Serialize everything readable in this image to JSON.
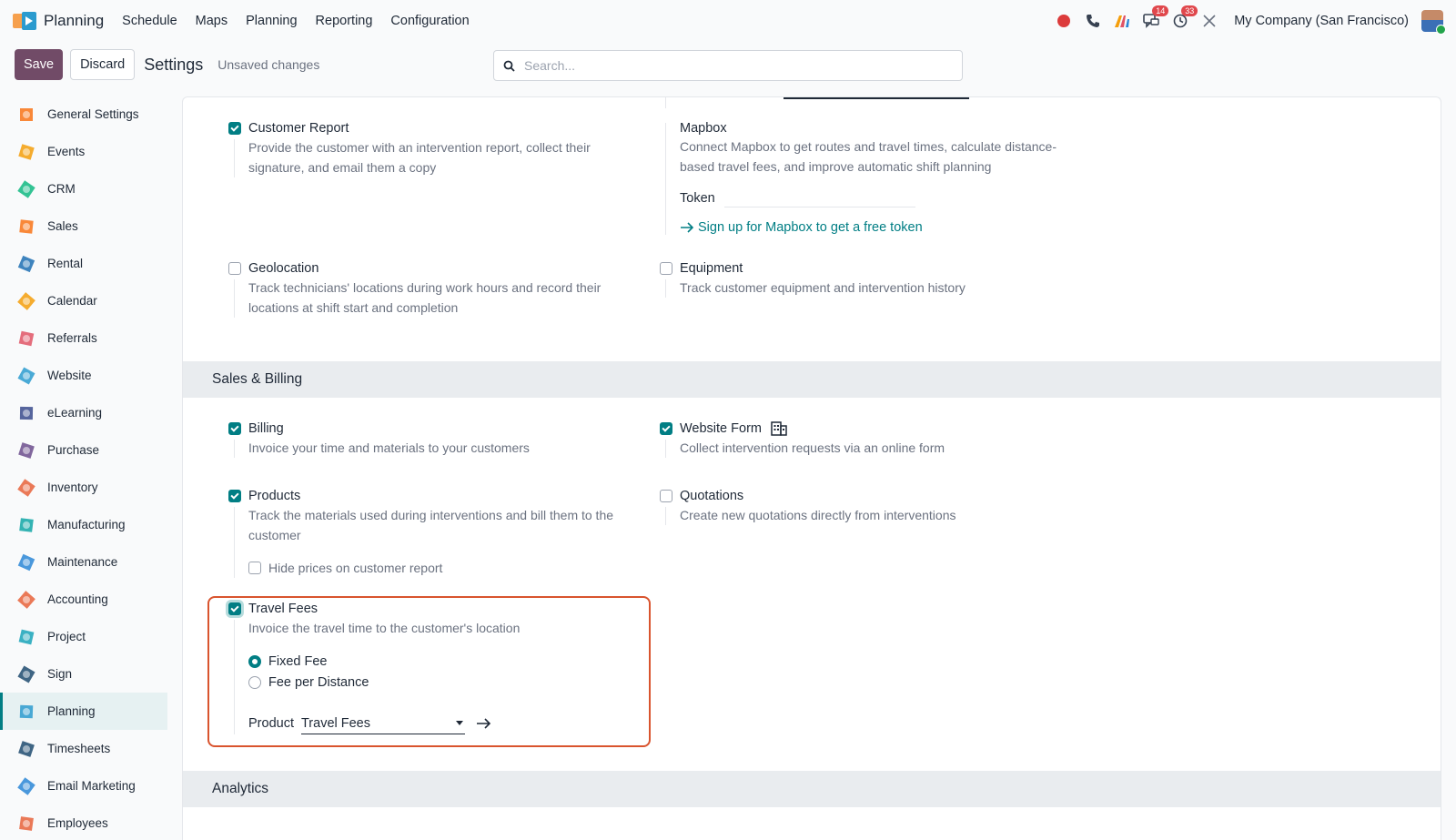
{
  "topbar": {
    "app_name": "Planning",
    "menu": [
      "Schedule",
      "Maps",
      "Planning",
      "Reporting",
      "Configuration"
    ],
    "messages_badge": "14",
    "activities_badge": "33",
    "company": "My Company (San Francisco)"
  },
  "controls": {
    "save": "Save",
    "discard": "Discard",
    "title": "Settings",
    "status": "Unsaved changes",
    "search_placeholder": "Search..."
  },
  "sidebar": {
    "items": [
      {
        "label": "General Settings",
        "icon": "general-settings-icon",
        "color": "#f97316"
      },
      {
        "label": "Events",
        "icon": "events-icon",
        "color": "#f59e0b"
      },
      {
        "label": "CRM",
        "icon": "crm-icon",
        "color": "#10b981"
      },
      {
        "label": "Sales",
        "icon": "sales-icon",
        "color": "#f97316"
      },
      {
        "label": "Rental",
        "icon": "rental-icon",
        "color": "#1e6fb3"
      },
      {
        "label": "Calendar",
        "icon": "calendar-icon",
        "color": "#f59e0b"
      },
      {
        "label": "Referrals",
        "icon": "referrals-icon",
        "color": "#e05365"
      },
      {
        "label": "Website",
        "icon": "website-icon",
        "color": "#2b9bcf"
      },
      {
        "label": "eLearning",
        "icon": "elearning-icon",
        "color": "#3a4a8c"
      },
      {
        "label": "Purchase",
        "icon": "purchase-icon",
        "color": "#6c4c8c"
      },
      {
        "label": "Inventory",
        "icon": "inventory-icon",
        "color": "#e8613a"
      },
      {
        "label": "Manufacturing",
        "icon": "manufacturing-icon",
        "color": "#12a6a6"
      },
      {
        "label": "Maintenance",
        "icon": "maintenance-icon",
        "color": "#2b86d6"
      },
      {
        "label": "Accounting",
        "icon": "accounting-icon",
        "color": "#e8613a"
      },
      {
        "label": "Project",
        "icon": "project-icon",
        "color": "#1aa3b8"
      },
      {
        "label": "Sign",
        "icon": "sign-icon",
        "color": "#1f4a6e"
      },
      {
        "label": "Planning",
        "icon": "planning-icon",
        "color": "#2b9bcf"
      },
      {
        "label": "Timesheets",
        "icon": "timesheets-icon",
        "color": "#1f4a6e"
      },
      {
        "label": "Email Marketing",
        "icon": "email-marketing-icon",
        "color": "#2b86d6"
      },
      {
        "label": "Employees",
        "icon": "employees-icon",
        "color": "#e8613a"
      }
    ],
    "active": "Planning"
  },
  "settings": {
    "customer_report": {
      "title": "Customer Report",
      "desc1": "Provide the customer with an intervention report, collect their",
      "desc2": "signature, and email them a copy"
    },
    "mapbox": {
      "title": "Mapbox",
      "desc1": "Connect Mapbox to get routes and travel times, calculate distance-",
      "desc2": "based travel fees, and improve automatic shift planning",
      "token_label": "Token",
      "link": "Sign up for Mapbox to get a free token"
    },
    "geolocation": {
      "title": "Geolocation",
      "desc1": "Track technicians' locations during work hours and record their",
      "desc2": "locations at shift start and completion"
    },
    "equipment": {
      "title": "Equipment",
      "desc1": "Track customer equipment and intervention history"
    },
    "sales_billing_header": "Sales & Billing",
    "billing": {
      "title": "Billing",
      "desc1": "Invoice your time and materials to your customers"
    },
    "website_form": {
      "title": "Website Form",
      "desc1": "Collect intervention requests via an online form"
    },
    "products": {
      "title": "Products",
      "desc1": "Track the materials used during interventions and bill them to the",
      "desc2": "customer",
      "sub_option": "Hide prices on customer report"
    },
    "quotations": {
      "title": "Quotations",
      "desc1": "Create new quotations directly from interventions"
    },
    "travel_fees": {
      "title": "Travel Fees",
      "desc1": "Invoice the travel time to the customer's location",
      "option_fixed": "Fixed Fee",
      "option_distance": "Fee per Distance",
      "product_label": "Product",
      "product_value": "Travel Fees"
    },
    "analytics_header": "Analytics"
  },
  "colors": {
    "primary": "#714b67",
    "accent": "#017e84",
    "highlight": "#d9542e"
  }
}
